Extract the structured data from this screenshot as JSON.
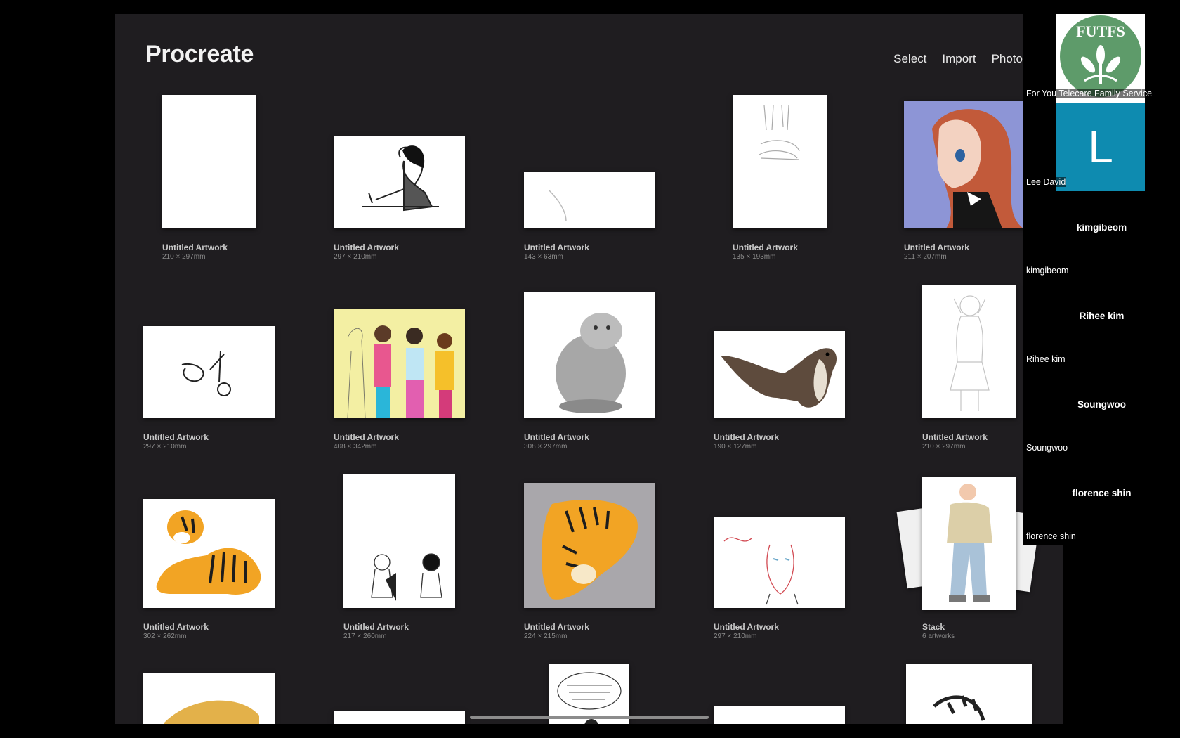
{
  "app": {
    "title": "Procreate",
    "actions": [
      "Select",
      "Import",
      "Photo"
    ]
  },
  "gallery": [
    {
      "title": "Untitled Artwork",
      "dims": "210 × 297mm",
      "thumb": "blank"
    },
    {
      "title": "Untitled Artwork",
      "dims": "297 × 210mm",
      "thumb": "girl-writing-sketch"
    },
    {
      "title": "Untitled Artwork",
      "dims": "143 × 63mm",
      "thumb": "single-stroke"
    },
    {
      "title": "Untitled Artwork",
      "dims": "135 × 193mm",
      "thumb": "legs-sketch"
    },
    {
      "title": "Untitled Artwork",
      "dims": "211 × 207mm",
      "thumb": "anime-girl-profile"
    },
    {
      "title": "Untitled Artwork",
      "dims": "297 × 210mm",
      "thumb": "ink-doodle"
    },
    {
      "title": "Untitled Artwork",
      "dims": "408 × 342mm",
      "thumb": "four-girls-colored"
    },
    {
      "title": "Untitled Artwork",
      "dims": "308 × 297mm",
      "thumb": "pallas-cat"
    },
    {
      "title": "Untitled Artwork",
      "dims": "190 × 127mm",
      "thumb": "otter"
    },
    {
      "title": "Untitled Artwork",
      "dims": "210 × 297mm",
      "thumb": "figure-pencil-sketch"
    },
    {
      "title": "Untitled Artwork",
      "dims": "302 × 262mm",
      "thumb": "lying-tiger"
    },
    {
      "title": "Untitled Artwork",
      "dims": "217 × 260mm",
      "thumb": "kids-sketch"
    },
    {
      "title": "Untitled Artwork",
      "dims": "224 × 215mm",
      "thumb": "crouching-tiger"
    },
    {
      "title": "Untitled Artwork",
      "dims": "297 × 210mm",
      "thumb": "girl-red-lines"
    },
    {
      "title": "Stack",
      "dims": "6 artworks",
      "thumb": "boy-standing"
    },
    {
      "title": "",
      "dims": "",
      "thumb": "tiger-partial"
    },
    {
      "title": "",
      "dims": "",
      "thumb": "blank"
    },
    {
      "title": "",
      "dims": "",
      "thumb": "speech-bubble-comic"
    },
    {
      "title": "",
      "dims": "",
      "thumb": "blank"
    },
    {
      "title": "",
      "dims": "",
      "thumb": "striped-tail"
    }
  ],
  "participants": [
    {
      "name": "For You Telecare Family Service",
      "avatar": "FUTFS",
      "type": "logo",
      "logo_color": "#5e9b6a"
    },
    {
      "name": "Lee David",
      "avatar": "L",
      "type": "letter",
      "color": "#0e8bb0"
    },
    {
      "name": "kimgibeom",
      "center_name": "kimgibeom",
      "type": "name"
    },
    {
      "name": "Rihee kim",
      "center_name": "Rihee kim",
      "type": "name"
    },
    {
      "name": "Soungwoo",
      "center_name": "Soungwoo",
      "type": "name"
    },
    {
      "name": "florence shin",
      "center_name": "florence shin",
      "type": "name"
    }
  ]
}
